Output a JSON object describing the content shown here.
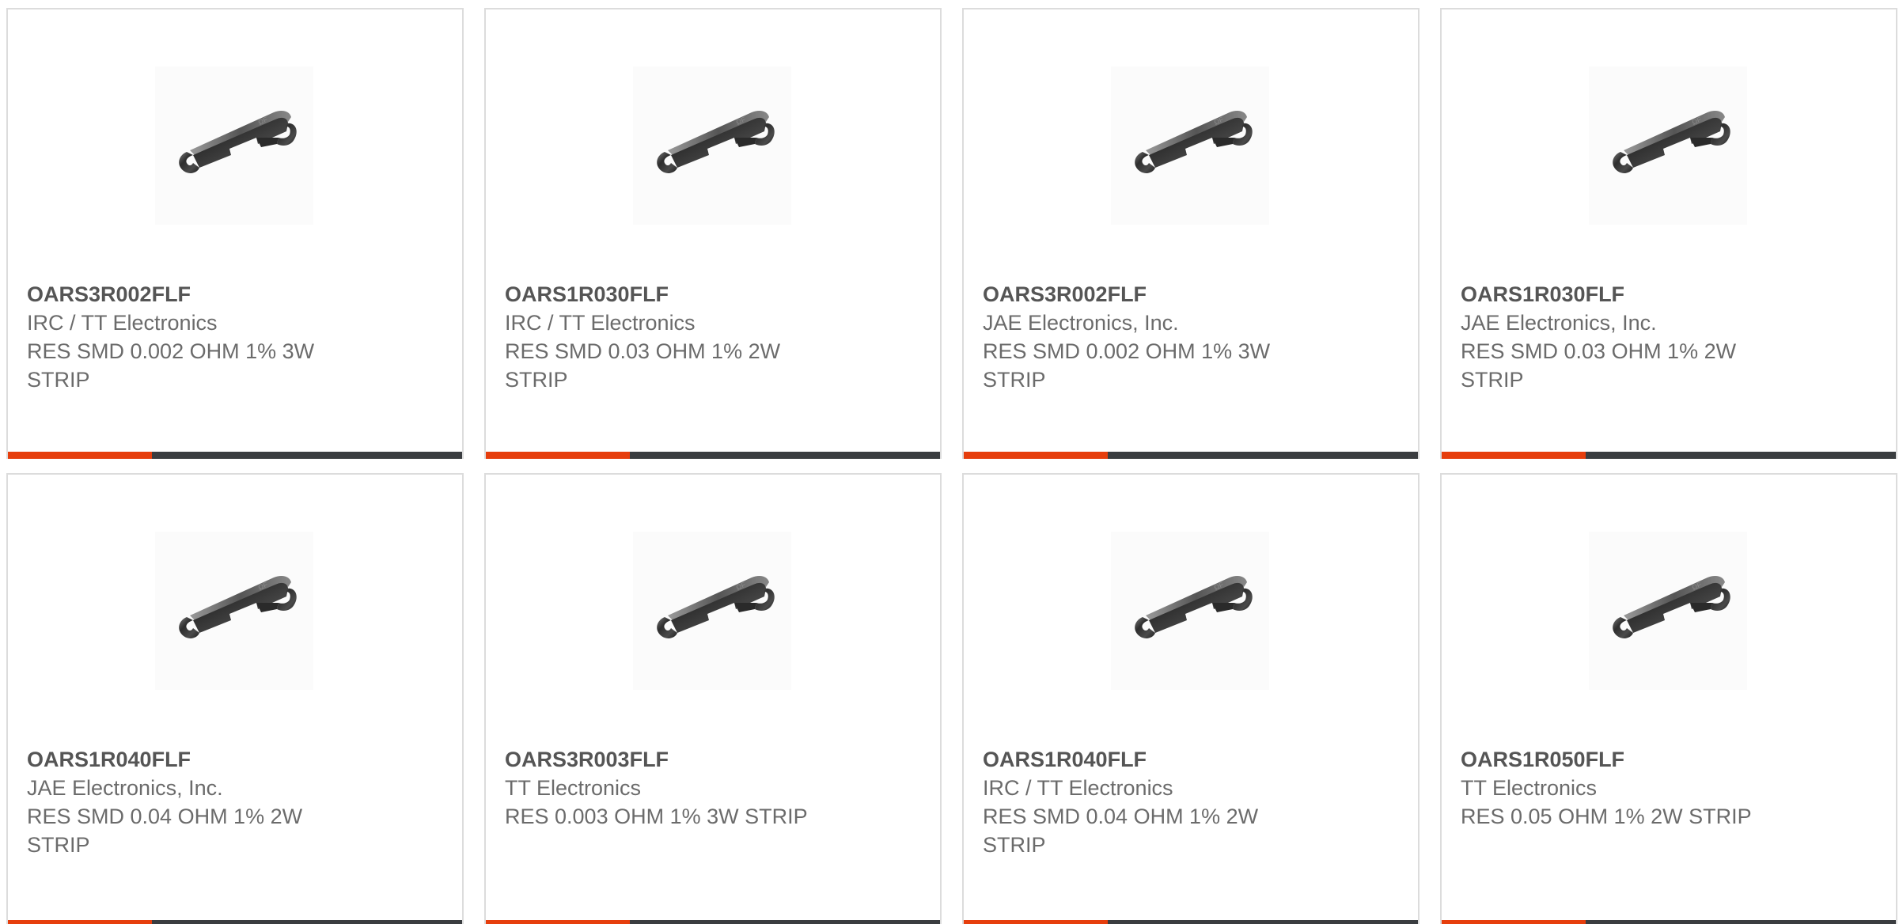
{
  "colors": {
    "accent": "#e63e0d",
    "bar": "#3a3d40",
    "border": "#dcdcdc",
    "text": "#6b6b6b"
  },
  "products": [
    {
      "part_number": "OARS3R002FLF",
      "manufacturer": "IRC / TT Electronics",
      "description": "RES SMD 0.002 OHM 1% 3W STRIP",
      "image_icon": "resistor-strip-image"
    },
    {
      "part_number": "OARS1R030FLF",
      "manufacturer": "IRC / TT Electronics",
      "description": "RES SMD 0.03 OHM 1% 2W STRIP",
      "image_icon": "resistor-strip-image"
    },
    {
      "part_number": "OARS3R002FLF",
      "manufacturer": "JAE Electronics, Inc.",
      "description": "RES SMD 0.002 OHM 1% 3W STRIP",
      "image_icon": "resistor-strip-image"
    },
    {
      "part_number": "OARS1R030FLF",
      "manufacturer": "JAE Electronics, Inc.",
      "description": "RES SMD 0.03 OHM 1% 2W STRIP",
      "image_icon": "resistor-strip-image"
    },
    {
      "part_number": "OARS1R040FLF",
      "manufacturer": "JAE Electronics, Inc.",
      "description": "RES SMD 0.04 OHM 1% 2W STRIP",
      "image_icon": "resistor-strip-image"
    },
    {
      "part_number": "OARS3R003FLF",
      "manufacturer": "TT Electronics",
      "description": "RES 0.003 OHM 1% 3W STRIP",
      "image_icon": "resistor-strip-image"
    },
    {
      "part_number": "OARS1R040FLF",
      "manufacturer": "IRC / TT Electronics",
      "description": "RES SMD 0.04 OHM 1% 2W STRIP",
      "image_icon": "resistor-strip-image"
    },
    {
      "part_number": "OARS1R050FLF",
      "manufacturer": "TT Electronics",
      "description": "RES 0.05 OHM 1% 2W STRIP",
      "image_icon": "resistor-strip-image"
    }
  ]
}
